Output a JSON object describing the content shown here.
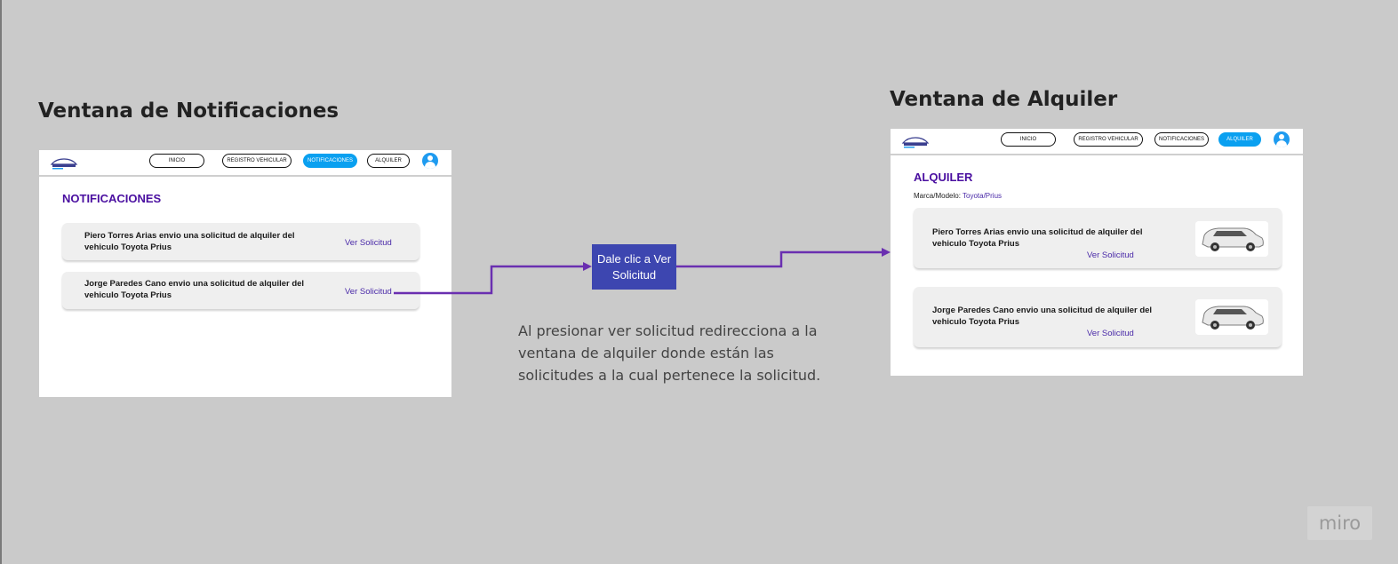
{
  "board": {
    "left_title": "Ventana de Notificaciones",
    "right_title": "Ventana de Alquiler",
    "callout": "Dale clic a Ver Solicitud",
    "note": "Al presionar ver solicitud redirecciona a la ventana de alquiler donde están las solicitudes a la cual pertenece la solicitud.",
    "watermark": "miro",
    "arrow_color": "#6a2fb0",
    "callout_color": "#3d46b0"
  },
  "nav": {
    "logo_text": "AUTOMOVILE",
    "inicio": "INICIO",
    "registro": "REGISTRO VEHICULAR",
    "notificaciones": "NOTIFICACIONES",
    "alquiler": "ALQUILER",
    "avatar_icon": "user-avatar-icon",
    "active_color": "#0aa0f0"
  },
  "notifications": {
    "heading": "NOTIFICACIONES",
    "items": [
      {
        "text": "Piero Torres Arias envio una solicitud de alquiler del vehiculo Toyota Prius",
        "link": "Ver Solicitud"
      },
      {
        "text": "Jorge Paredes Cano envio una solicitud de alquiler del vehiculo Toyota Prius",
        "link": "Ver Solicitud"
      }
    ]
  },
  "rental": {
    "heading": "ALQUILER",
    "model_label": "Marca/Modelo:",
    "model_value": "Toyota/Prius",
    "items": [
      {
        "text": "Piero Torres Arias envio una solicitud de alquiler del vehiculo Toyota Prius",
        "link": "Ver Solicitud",
        "image": "car-photo"
      },
      {
        "text": "Jorge Paredes Cano  envio una solicitud de alquiler del vehiculo Toyota Prius",
        "link": "Ver Solicitud",
        "image": "car-photo"
      }
    ]
  }
}
